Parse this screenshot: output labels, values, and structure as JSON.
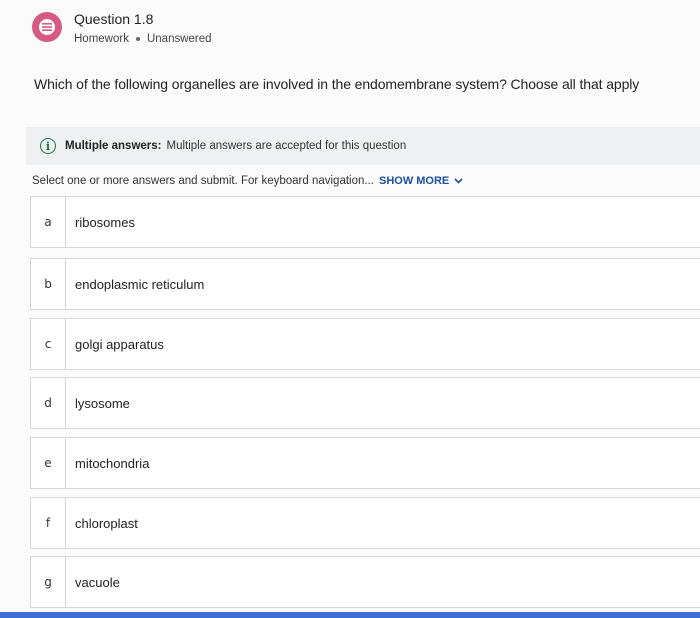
{
  "header": {
    "icon": "question-list-icon",
    "title": "Question 1.8",
    "type": "Homework",
    "status": "Unanswered"
  },
  "prompt": "Which of the following organelles are involved in the endomembrane system? Choose all that apply",
  "info": {
    "icon": "info-icon",
    "label": "Multiple answers:",
    "text": "Multiple answers are accepted for this question"
  },
  "instructions": {
    "text": "Select one or more answers and submit. For keyboard navigation...",
    "show_more": "SHOW MORE",
    "chevron_icon": "chevron-down-icon"
  },
  "options": [
    {
      "letter": "a",
      "text": "ribosomes"
    },
    {
      "letter": "b",
      "text": "endoplasmic reticulum"
    },
    {
      "letter": "c",
      "text": "golgi apparatus"
    },
    {
      "letter": "d",
      "text": "lysosome"
    },
    {
      "letter": "e",
      "text": "mitochondria"
    },
    {
      "letter": "f",
      "text": "chloroplast"
    },
    {
      "letter": "g",
      "text": "vacuole"
    }
  ],
  "colors": {
    "icon_pink": "#d65a84",
    "info_green": "#1a7a3c",
    "link_blue": "#1f4fa0",
    "accent_bar": "#3b6fd1"
  }
}
